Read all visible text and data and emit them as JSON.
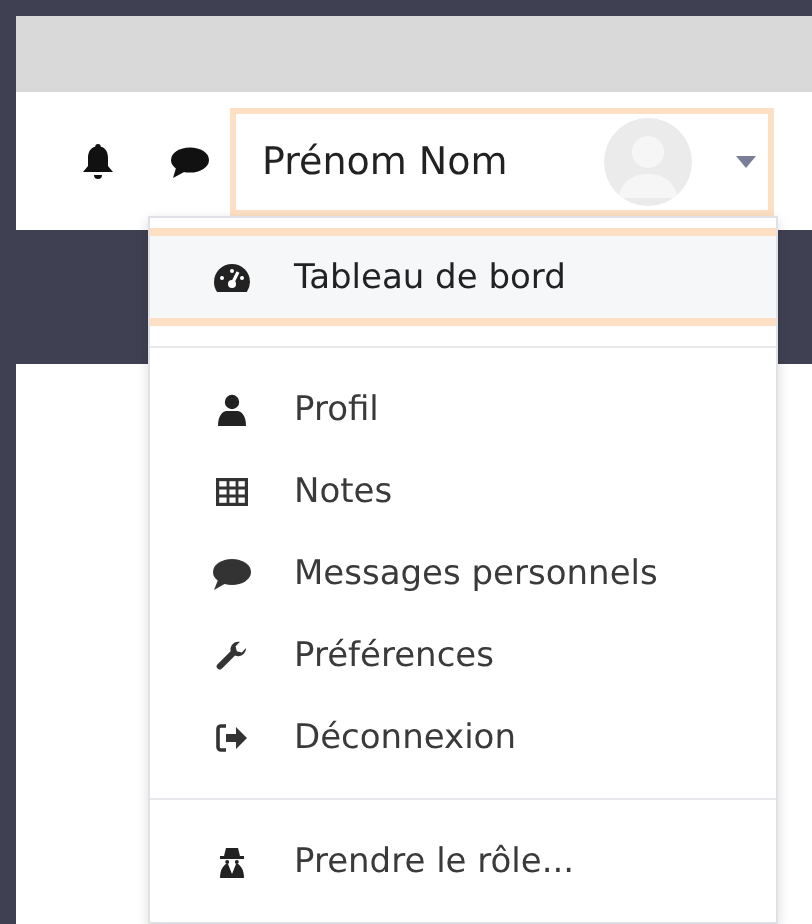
{
  "navbar": {
    "user_name": "Prénom Nom"
  },
  "user_menu": {
    "expanded": true,
    "groups": [
      [
        {
          "label": "Tableau de bord",
          "selected": true
        }
      ],
      [
        {
          "label": "Profil",
          "selected": false
        },
        {
          "label": "Notes",
          "selected": false
        },
        {
          "label": "Messages personnels",
          "selected": false
        },
        {
          "label": "Préférences",
          "selected": false
        },
        {
          "label": "Déconnexion",
          "selected": false
        }
      ],
      [
        {
          "label": "Prendre le rôle...",
          "selected": false
        }
      ]
    ]
  }
}
